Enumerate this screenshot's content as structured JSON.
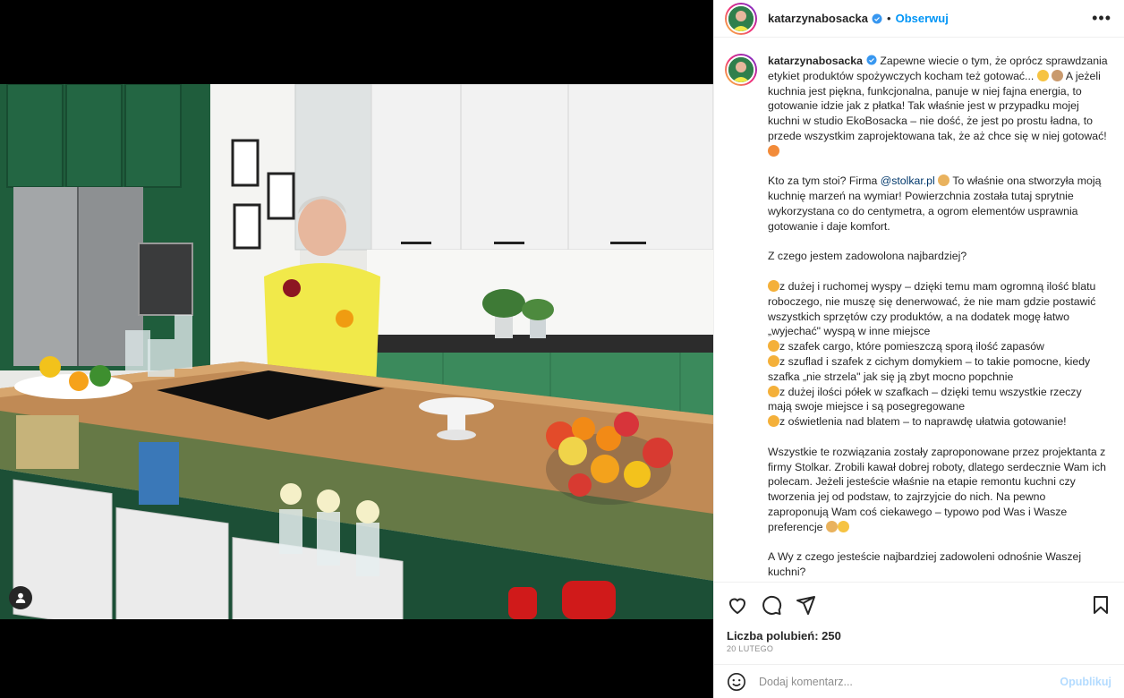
{
  "post": {
    "username": "katarzynabosacka",
    "follow_label": "Obserwuj",
    "separator": "•",
    "more_label": "•••",
    "caption_paragraphs": [
      [
        "Zapewne wiecie o tym, że oprócz sprawdzania etykiet produktów spożywczych kocham też gotować... ",
        "emoji:smile",
        " ",
        "emoji:chef",
        " A jeżeli kuchnia jest piękna, funkcjonalna, panuje w niej fajna energia, to gotowanie idzie jak z płatka! Tak właśnie jest w przypadku mojej kuchni w studio EkoBosacka – nie dość, że jest po prostu ładna, to przede wszystkim zaprojektowana tak, że aż chce się w niej gotować! ",
        "emoji:heart-eyes"
      ],
      [
        "Kto za tym stoi? Firma ",
        "mention:@stolkar.pl",
        " ",
        "emoji:pray",
        " To właśnie ona stworzyła moją kuchnię marzeń na wymiar! Powierzchnia została tutaj sprytnie wykorzystana co do centymetra, a ogrom elementów usprawnia gotowanie i daje komfort."
      ],
      [
        "Z czego jestem zadowolona najbardziej?"
      ],
      [
        "emoji:point",
        "z dużej i ruchomej wyspy – dzięki temu mam ogromną ilość blatu roboczego, nie muszę się denerwować, że nie mam gdzie postawić wszystkich sprzętów czy produktów, a na dodatek mogę łatwo „wyjechać\" wyspą w inne miejsce",
        "br",
        "emoji:point",
        "z szafek cargo, które pomieszczą sporą ilość zapasów",
        "br",
        "emoji:point",
        "z szuflad i szafek z cichym domykiem – to takie pomocne, kiedy szafka „nie strzela\" jak się ją zbyt mocno popchnie",
        "br",
        "emoji:point",
        "z dużej ilości półek w szafkach – dzięki temu wszystkie rzeczy mają swoje miejsce i są posegregowane",
        "br",
        "emoji:point",
        "z oświetlenia nad blatem – to naprawdę ułatwia gotowanie!"
      ],
      [
        "Wszystkie te rozwiązania zostały zaproponowane przez projektanta z firmy Stolkar. Zrobili kawał dobrej roboty, dlatego serdecznie Wam ich polecam. Jeżeli jesteście właśnie na etapie remontu kuchni czy tworzenia jej od podstaw, to zajrzyjcie do nich. Na pewno zaproponują Wam coś ciekawego – typowo pod Was i Wasze preferencje ",
        "emoji:pray",
        "emoji:cool"
      ],
      [
        "A Wy z czego jesteście najbardziej zadowoleni odnośnie Waszej kuchni?"
      ]
    ],
    "likes": "Liczba polubień: 250",
    "date": "20 LUTEGO",
    "comment_placeholder": "Dodaj komentarz...",
    "post_button": "Opublikuj"
  },
  "colors": {
    "link_blue": "#0095f6",
    "mention": "#00376b",
    "verified": "#3897f0",
    "post_disabled": "#b3dbff"
  },
  "icons": [
    "verified-icon",
    "like-icon",
    "comment-icon",
    "share-icon",
    "save-icon",
    "emoji-icon",
    "user-tag-icon"
  ]
}
